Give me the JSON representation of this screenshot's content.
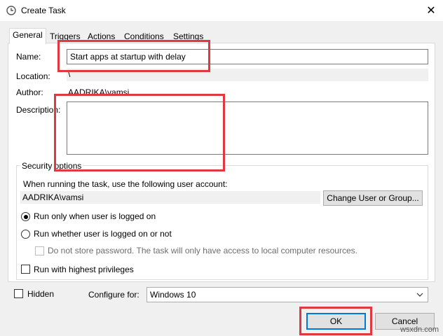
{
  "window": {
    "title": "Create Task",
    "close_glyph": "✕"
  },
  "tabs": [
    {
      "label": "General",
      "active": true
    },
    {
      "label": "Triggers"
    },
    {
      "label": "Actions"
    },
    {
      "label": "Conditions"
    },
    {
      "label": "Settings"
    }
  ],
  "general": {
    "name_label": "Name:",
    "name_value": "Start apps at startup with delay",
    "location_label": "Location:",
    "location_value": "\\",
    "author_label": "Author:",
    "author_value": "AADRIKA\\vamsi",
    "description_label": "Description:",
    "description_value": ""
  },
  "security": {
    "legend": "Security options",
    "account_prompt": "When running the task, use the following user account:",
    "account_value": "AADRIKA\\vamsi",
    "change_user_button": "Change User or Group...",
    "radio_logged_on": "Run only when user is logged on",
    "radio_logged_on_or_not": "Run whether user is logged on or not",
    "selected_radio": "radio_logged_on",
    "no_store_password": "Do not store password.  The task will only have access to local computer resources.",
    "highest_privileges": "Run with highest privileges"
  },
  "bottom": {
    "hidden_label": "Hidden",
    "configure_label": "Configure for:",
    "configure_value": "Windows 10"
  },
  "buttons": {
    "ok": "OK",
    "cancel": "Cancel"
  },
  "watermark": "wsxdn.com",
  "colors": {
    "highlight": "#e0383e",
    "default_button_border": "#0078d7"
  }
}
